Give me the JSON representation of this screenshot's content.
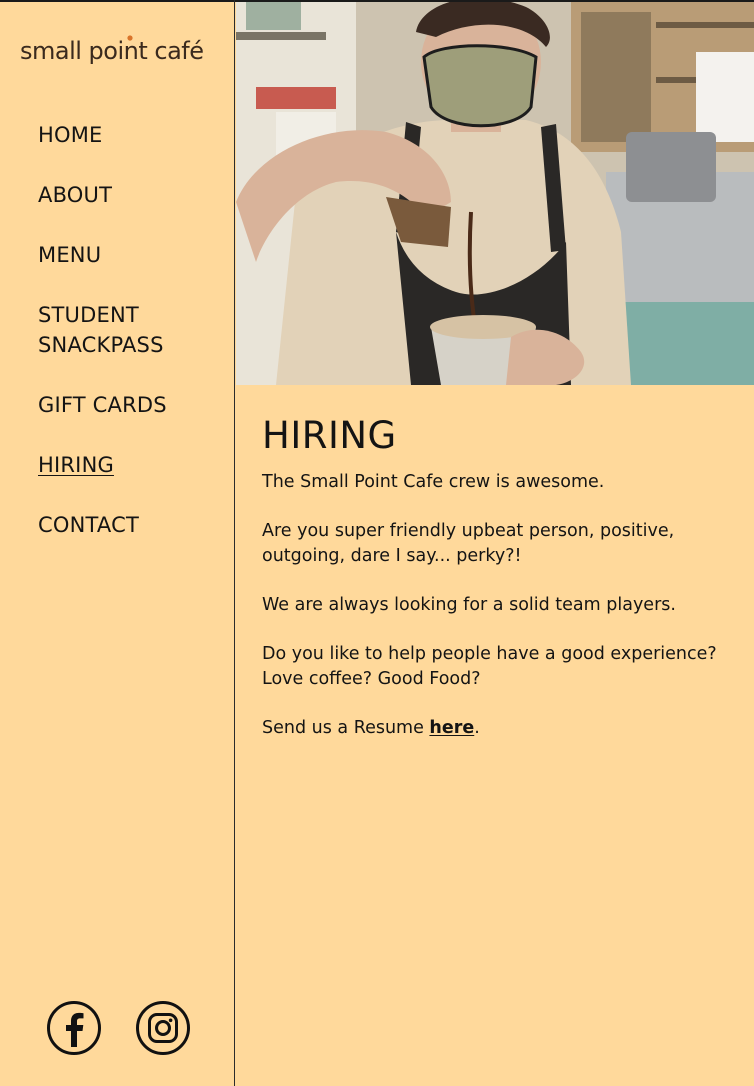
{
  "brand": {
    "logo_text": "small point café"
  },
  "nav": {
    "items": [
      {
        "label": "HOME"
      },
      {
        "label": "ABOUT"
      },
      {
        "label": "MENU"
      },
      {
        "label_line1": "STUDENT",
        "label_line2": "SNACKPASS"
      },
      {
        "label": "GIFT CARDS"
      },
      {
        "label": "HIRING"
      },
      {
        "label": "CONTACT"
      }
    ],
    "active": "HIRING"
  },
  "social": {
    "facebook_icon": "facebook-icon",
    "instagram_icon": "instagram-icon"
  },
  "hero": {
    "image_subject": "barista pouring espresso over iced drink"
  },
  "main": {
    "title": "HIRING",
    "paragraphs": [
      "The Small Point Cafe crew is awesome.",
      "Are you super friendly upbeat person, positive, outgoing, dare I say... perky?!",
      "We are always looking for a solid team players.",
      "Do you like to help people have a good experience? Love coffee? Good Food?"
    ],
    "resume_prefix": "Send us a Resume ",
    "resume_link": "here",
    "resume_suffix": "."
  },
  "colors": {
    "background": "#ffd99b",
    "text": "#141414",
    "logo_accent": "#d9742a"
  }
}
